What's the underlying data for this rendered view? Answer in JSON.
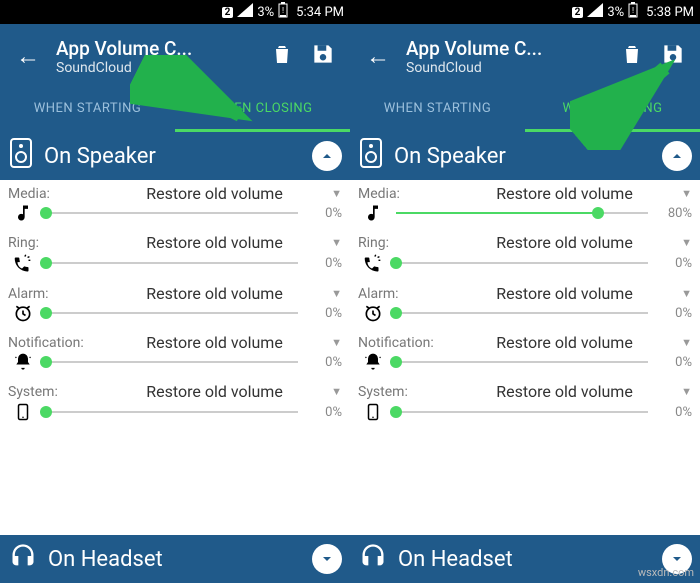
{
  "panes": [
    {
      "status": {
        "sim": "2",
        "battery": "3%",
        "time": "5:34 PM"
      },
      "toolbar": {
        "title": "App Volume C...",
        "subtitle": "SoundCloud"
      },
      "tabs": {
        "starting": "WHEN STARTING",
        "closing": "WHEN CLOSING",
        "active": "closing"
      },
      "speaker_label": "On Speaker",
      "headset_label": "On Headset",
      "rows": [
        {
          "label": "Media:",
          "value": "Restore old volume",
          "pct": "0%",
          "fill": 0
        },
        {
          "label": "Ring:",
          "value": "Restore old volume",
          "pct": "0%",
          "fill": 0
        },
        {
          "label": "Alarm:",
          "value": "Restore old volume",
          "pct": "0%",
          "fill": 0
        },
        {
          "label": "Notification:",
          "value": "Restore old volume",
          "pct": "0%",
          "fill": 0
        },
        {
          "label": "System:",
          "value": "Restore old volume",
          "pct": "0%",
          "fill": 0
        }
      ],
      "arrow_color": "#22b14c"
    },
    {
      "status": {
        "sim": "2",
        "battery": "3%",
        "time": "5:38 PM"
      },
      "toolbar": {
        "title": "App Volume C...",
        "subtitle": "SoundCloud"
      },
      "tabs": {
        "starting": "WHEN STARTING",
        "closing": "WHEN CLOSING",
        "active": "closing"
      },
      "speaker_label": "On Speaker",
      "headset_label": "On Headset",
      "rows": [
        {
          "label": "Media:",
          "value": "Restore old volume",
          "pct": "80%",
          "fill": 80
        },
        {
          "label": "Ring:",
          "value": "Restore old volume",
          "pct": "0%",
          "fill": 0
        },
        {
          "label": "Alarm:",
          "value": "Restore old volume",
          "pct": "0%",
          "fill": 0
        },
        {
          "label": "Notification:",
          "value": "Restore old volume",
          "pct": "0%",
          "fill": 0
        },
        {
          "label": "System:",
          "value": "Restore old volume",
          "pct": "0%",
          "fill": 0
        }
      ],
      "arrow_color": "#22b14c"
    }
  ],
  "icons": [
    "music",
    "ring",
    "alarm",
    "bell",
    "phone"
  ],
  "watermark": "wsxdn.com"
}
